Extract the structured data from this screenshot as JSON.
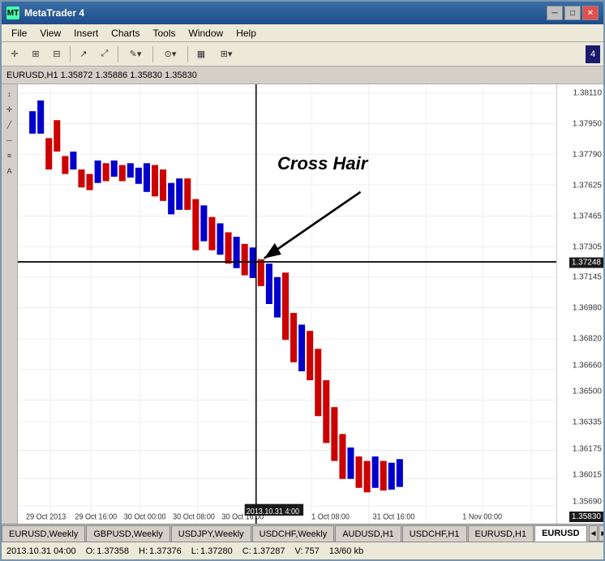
{
  "window": {
    "title": "MetaTrader 4"
  },
  "title_bar": {
    "icon_text": "MT",
    "title": "MetaTrader 4",
    "minimize": "─",
    "maximize": "□",
    "close": "✕"
  },
  "menu": {
    "items": [
      "File",
      "View",
      "Insert",
      "Charts",
      "Tools",
      "Window",
      "Help"
    ]
  },
  "toolbar": {
    "number": "4",
    "tools": [
      "↕",
      "↔",
      "⊕",
      "⊖",
      "→",
      "⇒",
      "✎",
      "⊙",
      "▦",
      "⊞"
    ]
  },
  "chart_header": {
    "symbol": "EURUSD,H1",
    "values": "1.35872  1.35886  1.35830  1.35830"
  },
  "chart": {
    "crosshair_label": "Cross Hair",
    "price_labels": [
      {
        "value": "1.38110",
        "y_pct": 2
      },
      {
        "value": "1.37950",
        "y_pct": 9
      },
      {
        "value": "1.37790",
        "y_pct": 16
      },
      {
        "value": "1.37625",
        "y_pct": 23
      },
      {
        "value": "1.37465",
        "y_pct": 30
      },
      {
        "value": "1.37305",
        "y_pct": 37
      },
      {
        "value": "1.37145",
        "y_pct": 44
      },
      {
        "value": "1.36980",
        "y_pct": 51
      },
      {
        "value": "1.36820",
        "y_pct": 58
      },
      {
        "value": "1.36660",
        "y_pct": 65
      },
      {
        "value": "1.36500",
        "y_pct": 71
      },
      {
        "value": "1.36335",
        "y_pct": 77
      },
      {
        "value": "1.36175",
        "y_pct": 83
      },
      {
        "value": "1.36015",
        "y_pct": 89
      },
      {
        "value": "1.35690",
        "y_pct": 96
      }
    ],
    "crosshair_price": "1.37248",
    "crosshair_price_y_pct": 40.5,
    "bottom_price": "1.35830",
    "time_labels": [
      {
        "label": "29 Oct 2013",
        "x_pct": 3
      },
      {
        "label": "29 Oct 16:00",
        "x_pct": 11
      },
      {
        "label": "30 Oct 00:00",
        "x_pct": 19
      },
      {
        "label": "30 Oct 08:00",
        "x_pct": 27
      },
      {
        "label": "30 Oct 16:00",
        "x_pct": 35
      },
      {
        "label": "2013.10.31 4:00",
        "x_pct": 46
      },
      {
        "label": "1 Oct 08:00",
        "x_pct": 57
      },
      {
        "label": "31 Oct 16:00",
        "x_pct": 69
      },
      {
        "label": "1 Nov 00:00",
        "x_pct": 80
      }
    ]
  },
  "tabs": [
    {
      "label": "EURUSD,Weekly",
      "active": false
    },
    {
      "label": "GBPUSD,Weekly",
      "active": false
    },
    {
      "label": "USDJPY,Weekly",
      "active": false
    },
    {
      "label": "USDCHF,Weekly",
      "active": false
    },
    {
      "label": "AUDUSD,H1",
      "active": false
    },
    {
      "label": "USDCHF,H1",
      "active": false
    },
    {
      "label": "EURUSD,H1",
      "active": false
    },
    {
      "label": "EURUSD",
      "active": true
    }
  ],
  "status_bar": {
    "datetime": "2013.10.31 04:00",
    "open_label": "O:",
    "open_val": "1.37358",
    "high_label": "H:",
    "high_val": "1.37376",
    "low_label": "L:",
    "low_val": "1.37280",
    "close_label": "C:",
    "close_val": "1.37287",
    "volume_label": "V:",
    "volume_val": "757",
    "size_label": "13/60 kb"
  }
}
